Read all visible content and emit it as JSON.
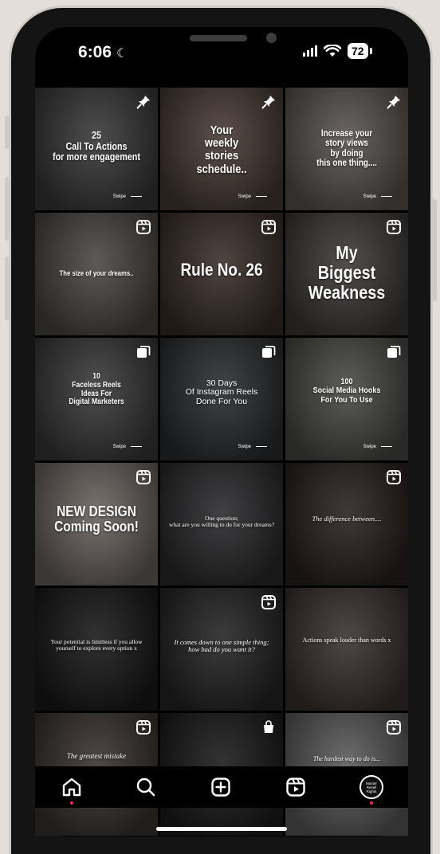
{
  "status": {
    "time": "6:06",
    "battery": "72"
  },
  "colors": {
    "accent": "#ff2a55",
    "background": "#000000",
    "frame": "#141414"
  },
  "grid": [
    {
      "badge": "pin-icon",
      "caption": "25\nCall To Actions\nfor more engagement",
      "swipe": "Swipe",
      "bg": "#3a3a3a"
    },
    {
      "badge": "pin-icon",
      "caption": "Your\nweekly\nstories\nschedule..",
      "swipe": "Swipe",
      "bg": "#4a3c36"
    },
    {
      "badge": "pin-icon",
      "caption": "Increase your\nstory views\nby doing\nthis one thing....",
      "swipe": "Swipe",
      "bg": "#5a5552"
    },
    {
      "badge": "reels-icon",
      "caption": "The size of your dreams..",
      "swipe": "",
      "bg": "#4b4745"
    },
    {
      "badge": "reels-icon",
      "caption": "Rule No. 26",
      "swipe": "",
      "bg": "#3b2f2a"
    },
    {
      "badge": "reels-icon",
      "caption": "My\nBiggest\nWeakness",
      "swipe": "",
      "bg": "#3e3b38"
    },
    {
      "badge": "carousel-icon",
      "caption": "10\nFaceless Reels\nIdeas For\nDigital Marketers",
      "swipe": "Swipe",
      "bg": "#3b3b3b"
    },
    {
      "badge": "carousel-icon",
      "caption": "30 Days\nOf Instagram Reels\nDone For You",
      "swipe": "Swipe",
      "bg": "#2c2e31"
    },
    {
      "badge": "carousel-icon",
      "caption": "100\nSocial Media Hooks\nFor You To Use",
      "swipe": "Swipe",
      "bg": "#4a4a48"
    },
    {
      "badge": "reels-icon",
      "caption": "NEW DESIGN\nComing Soon!",
      "swipe": "",
      "bg": "#6b6460"
    },
    {
      "badge": "",
      "caption": "One question;\nwhat are you willing to do for your dreams?",
      "swipe": "",
      "bg": "#2b2b2d"
    },
    {
      "badge": "reels-icon",
      "caption": "The difference between....",
      "swipe": "",
      "bg": "#2a2220"
    },
    {
      "badge": "",
      "caption": "Your potential is limitless if you allow\nyourself to explore every option x",
      "swipe": "",
      "bg": "#1a1a1a"
    },
    {
      "badge": "reels-icon",
      "caption": "It comes down to one simple thing;\nhow bad do you want it?",
      "swipe": "",
      "bg": "#262626"
    },
    {
      "badge": "",
      "caption": "Actions speak louder than words x",
      "swipe": "",
      "bg": "#3c3232"
    },
    {
      "badge": "reels-icon",
      "caption": "The greatest mistake",
      "swipe": "",
      "bg": "#3a3431"
    },
    {
      "badge": "shop-icon",
      "caption": "",
      "swipe": "",
      "bg": "#1c1c1c"
    },
    {
      "badge": "reels-icon",
      "caption": "The hardest way to do is...",
      "swipe": "",
      "bg": "#5c5c5c"
    }
  ],
  "tabbar": {
    "items": [
      {
        "name": "home-icon"
      },
      {
        "name": "search-icon"
      },
      {
        "name": "create-icon"
      },
      {
        "name": "reels-icon"
      },
      {
        "name": "profile-avatar",
        "label": "Master\nResell\nRights"
      }
    ]
  }
}
